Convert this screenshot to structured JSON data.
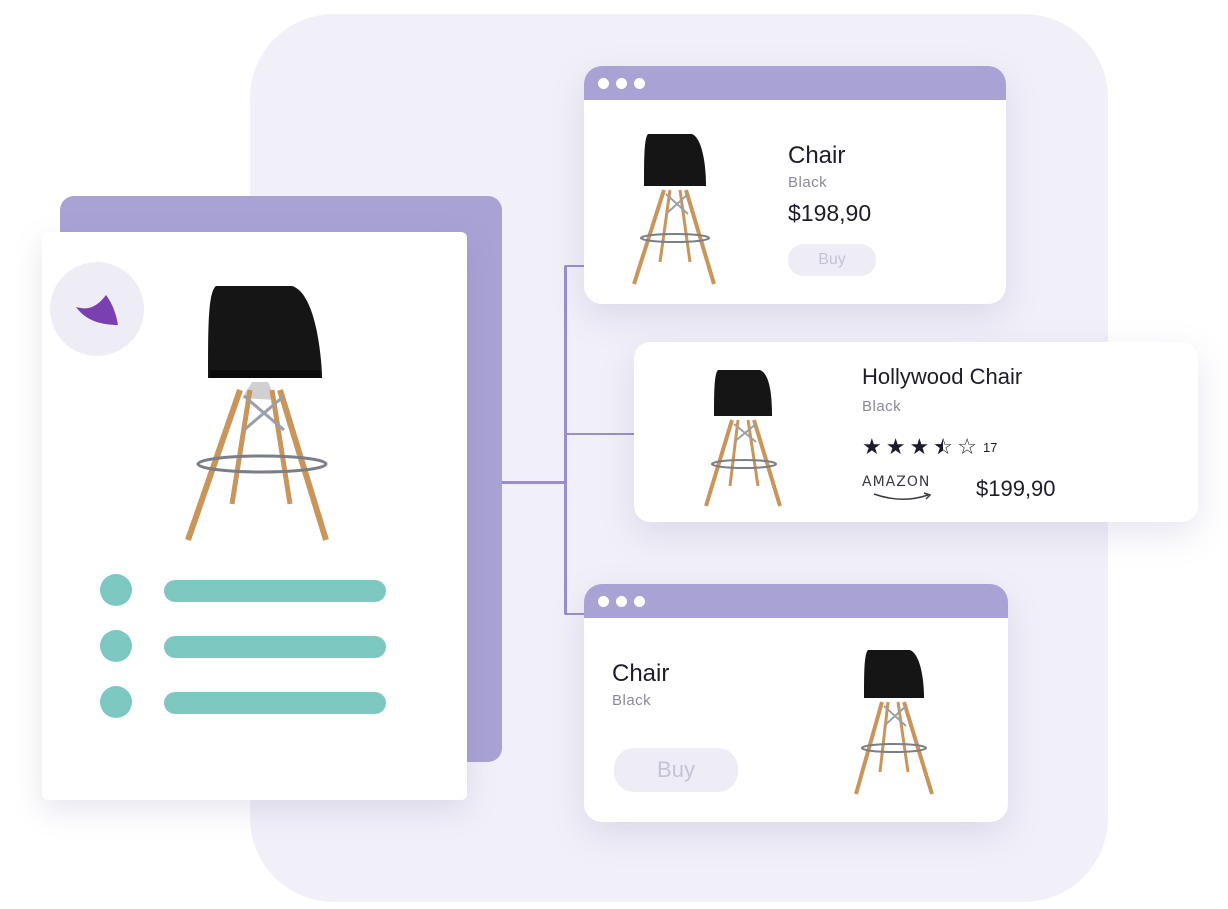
{
  "colors": {
    "backdrop": "#f1f0f8",
    "accent_lavender": "#a9a2d4",
    "connector": "#9b8dcc",
    "teal": "#7ec8c2",
    "logo_purple": "#7a3fb0"
  },
  "left_panel": {
    "logo_icon": "brand-logo-icon",
    "hero_icon": "chair-icon",
    "spec_rows": 3
  },
  "products": [
    {
      "title": "Chair",
      "subtitle": "Black",
      "price": "$198,90",
      "button_label": "Buy"
    },
    {
      "title": "Hollywood Chair",
      "subtitle": "Black",
      "rating": 3.5,
      "rating_max": 5,
      "review_count": "17",
      "retailer": "AMAZON",
      "price": "$199,90"
    },
    {
      "title": "Chair",
      "subtitle": "Black",
      "button_label": "Buy"
    }
  ]
}
